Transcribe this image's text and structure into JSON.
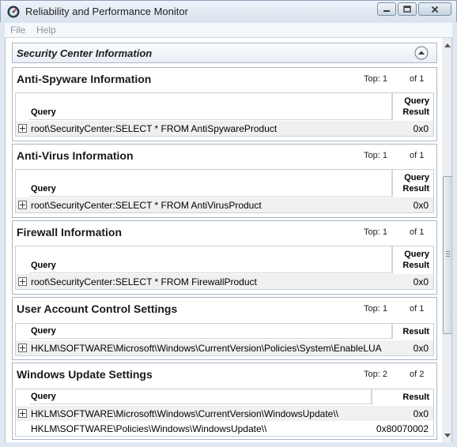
{
  "window": {
    "title": "Reliability and Performance Monitor",
    "icon": "performance-monitor-icon",
    "controls": [
      "minimize-icon",
      "maximize-icon",
      "close-icon"
    ]
  },
  "menu": {
    "file": "File",
    "help": "Help"
  },
  "section": {
    "title": "Security Center Information",
    "collapse_icon": "collapse-up-icon"
  },
  "labels": {
    "top": "Top:",
    "of": "of",
    "query": "Query",
    "query_result_line1": "Query",
    "query_result_line2": "Result",
    "result": "Result"
  },
  "panels": [
    {
      "title": "Anti-Spyware Information",
      "top": "1",
      "of": "1",
      "rows": [
        {
          "query": "root\\SecurityCenter:SELECT * FROM AntiSpywareProduct",
          "result": "0x0"
        }
      ]
    },
    {
      "title": "Anti-Virus Information",
      "top": "1",
      "of": "1",
      "rows": [
        {
          "query": "root\\SecurityCenter:SELECT * FROM AntiVirusProduct",
          "result": "0x0"
        }
      ]
    },
    {
      "title": "Firewall Information",
      "top": "1",
      "of": "1",
      "rows": [
        {
          "query": "root\\SecurityCenter:SELECT * FROM FirewallProduct",
          "result": "0x0"
        }
      ]
    },
    {
      "title": "User Account Control Settings",
      "top": "1",
      "of": "1",
      "rows": [
        {
          "query": "HKLM\\SOFTWARE\\Microsoft\\Windows\\CurrentVersion\\Policies\\System\\EnableLUA",
          "result": "0x0"
        }
      ]
    },
    {
      "title": "Windows Update Settings",
      "top": "2",
      "of": "2",
      "rows": [
        {
          "query": "HKLM\\SOFTWARE\\Microsoft\\Windows\\CurrentVersion\\WindowsUpdate\\\\",
          "result": "0x0"
        },
        {
          "query": "HKLM\\SOFTWARE\\Policies\\Windows\\WindowsUpdate\\\\",
          "result": "0x80070002"
        }
      ]
    }
  ],
  "colors": {
    "frame": "#dfe8f1",
    "panel_border": "#a9b6c4",
    "row_shade": "#f0f0f0"
  }
}
